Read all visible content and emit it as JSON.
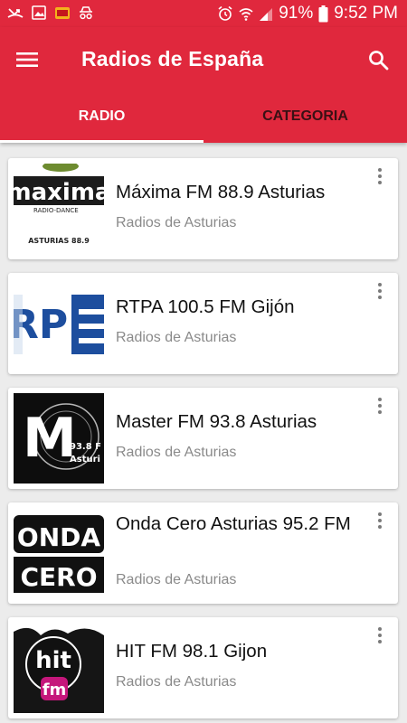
{
  "status_bar": {
    "battery": "91%",
    "time": "9:52 PM"
  },
  "app_bar": {
    "title": "Radios de España"
  },
  "tabs": [
    {
      "label": "RADIO",
      "active": true
    },
    {
      "label": "CATEGORIA",
      "active": false
    }
  ],
  "stations": [
    {
      "name": "Máxima FM 88.9 Asturias",
      "category": "Radios de Asturias",
      "logo": "maxima-fm-logo",
      "logo_text": [
        "maxima",
        "RADIO-DANCE",
        "ASTURIAS 88.9"
      ]
    },
    {
      "name": "RTPA 100.5 FM Gijón",
      "category": "Radios de Asturias",
      "logo": "rtpa-logo",
      "logo_text": [
        "RP"
      ]
    },
    {
      "name": "Master FM 93.8 Asturias",
      "category": "Radios de Asturias",
      "logo": "master-fm-logo",
      "logo_text": [
        "M",
        "93.8 F",
        "Asturi"
      ]
    },
    {
      "name": "Onda Cero Asturias 95.2 FM",
      "category": "Radios de Asturias",
      "logo": "onda-cero-logo",
      "logo_text": [
        "ONDA",
        "CERO"
      ]
    },
    {
      "name": "HIT FM 98.1 Gijon",
      "category": "Radios de Asturias",
      "logo": "hit-fm-logo",
      "logo_text": [
        "hit",
        "fm"
      ]
    }
  ],
  "colors": {
    "primary": "#e0283d",
    "tab_inactive_text": "#3a1014",
    "subtitle": "#8a8a8a",
    "background": "#ececec"
  }
}
